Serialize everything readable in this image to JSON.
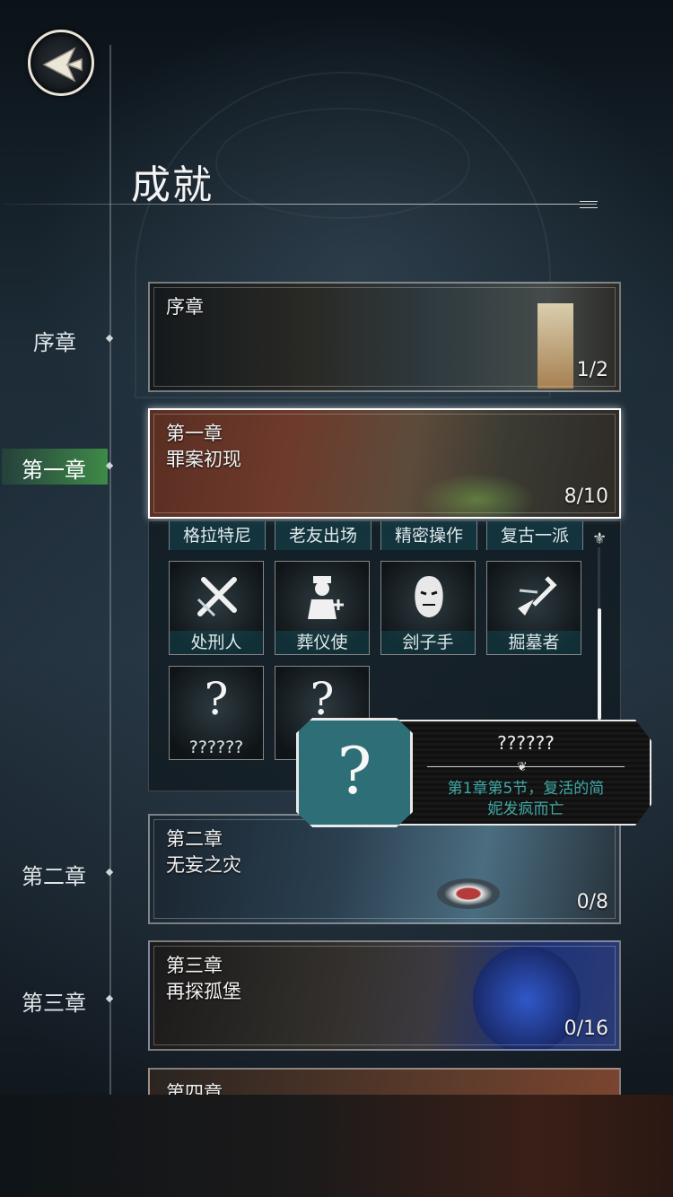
{
  "page": {
    "title": "成就"
  },
  "timeline": {
    "items": [
      {
        "label": "序章",
        "active": false
      },
      {
        "label": "第一章",
        "active": true
      },
      {
        "label": "第二章",
        "active": false
      },
      {
        "label": "第三章",
        "active": false
      }
    ],
    "active_color": "#3e8a47"
  },
  "chapters": [
    {
      "title": "序章",
      "subtitle": "",
      "progress": "1/2"
    },
    {
      "title": "第一章",
      "subtitle": "罪案初现",
      "progress": "8/10"
    },
    {
      "title": "第二章",
      "subtitle": "无妄之灾",
      "progress": "0/8"
    },
    {
      "title": "第三章",
      "subtitle": "再探孤堡",
      "progress": "0/16"
    },
    {
      "title": "第四章",
      "subtitle": "",
      "progress": ""
    }
  ],
  "achievements": {
    "row_top_labels": [
      "格拉特尼",
      "老友出场",
      "精密操作",
      "复古一派"
    ],
    "row_icons": [
      {
        "label": "处刑人",
        "icon": "crossed-blades-icon"
      },
      {
        "label": "葬仪使",
        "icon": "undertaker-figure-icon"
      },
      {
        "label": "刽子手",
        "icon": "masked-executioner-icon"
      },
      {
        "label": "掘墓者",
        "icon": "shovel-icon"
      }
    ],
    "locked": [
      {
        "label": "??????",
        "icon": "question-mark-icon"
      },
      {
        "label": "",
        "icon": "question-mark-icon"
      }
    ],
    "scroll_position": 0.3
  },
  "tooltip": {
    "title": "??????",
    "description_line1": "第1章第5节，复活的简",
    "description_line2": "妮发疯而亡",
    "icon": "question-mark-icon",
    "icon_bg_color": "#2e6f77",
    "desc_color": "#3fa9a6"
  }
}
